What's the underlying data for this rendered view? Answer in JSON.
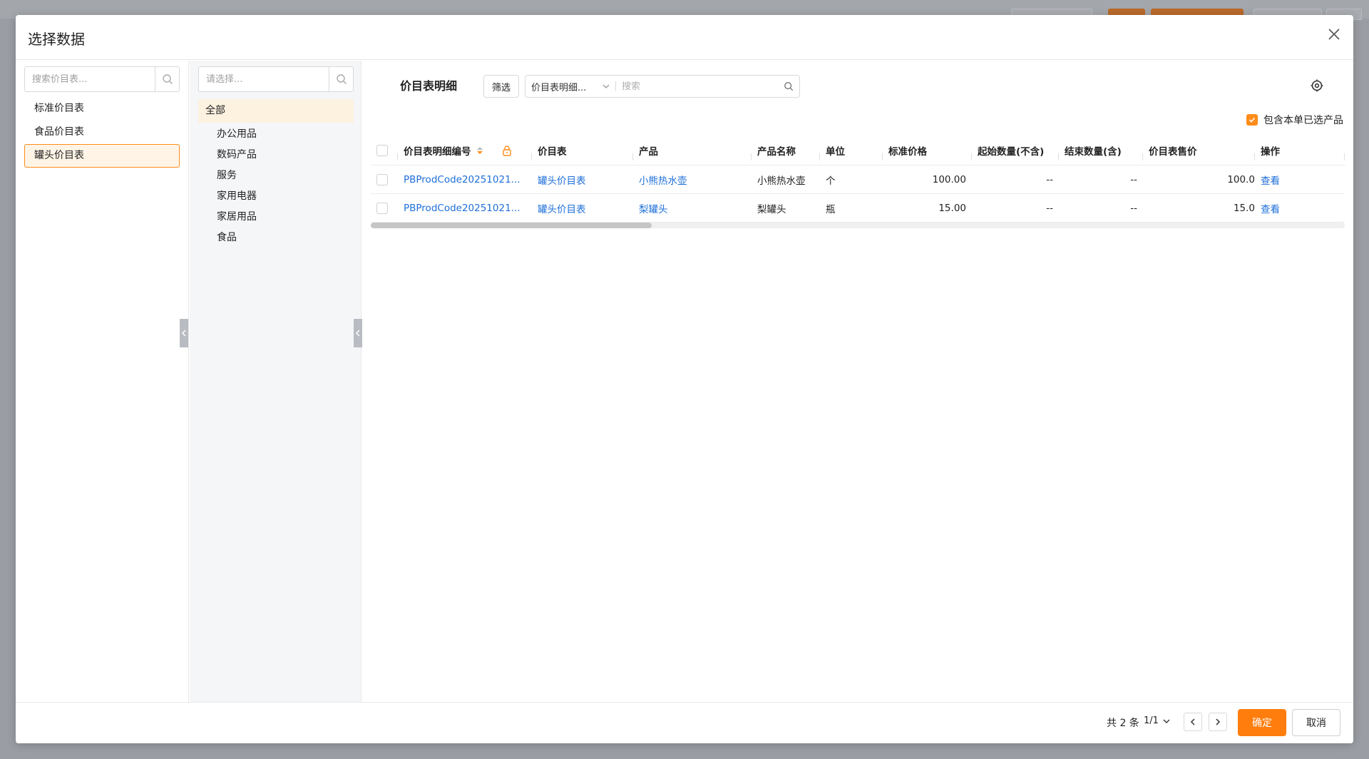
{
  "modal": {
    "title": "选择数据",
    "close_icon": "close-icon"
  },
  "price_list_panel": {
    "search_placeholder": "搜索价目表...",
    "items": [
      {
        "label": "标准价目表",
        "active": false
      },
      {
        "label": "食品价目表",
        "active": false
      },
      {
        "label": "罐头价目表",
        "active": true
      }
    ]
  },
  "category_panel": {
    "search_placeholder": "请选择...",
    "all_label": "全部",
    "items": [
      "办公用品",
      "数码产品",
      "服务",
      "家用电器",
      "家居用品",
      "食品"
    ]
  },
  "detail_panel": {
    "title": "价目表明细",
    "filter_label": "筛选",
    "field_select": "价目表明细...",
    "search_placeholder": "搜索",
    "include_checkbox_label": "包含本单已选产品",
    "include_checked": true
  },
  "table": {
    "columns": [
      "价目表明细编号",
      "价目表",
      "产品",
      "产品名称",
      "单位",
      "标准价格",
      "起始数量(不含)",
      "结束数量(含)",
      "价目表售价",
      "操作"
    ],
    "rows": [
      {
        "code": "PBProdCode20251021...",
        "price_list": "罐头价目表",
        "product": "小熊热水壶",
        "product_name": "小熊热水壶",
        "unit": "个",
        "std_price": "100.00",
        "start_qty": "--",
        "end_qty": "--",
        "sale_price": "100.0",
        "action": "查看"
      },
      {
        "code": "PBProdCode20251021...",
        "price_list": "罐头价目表",
        "product": "梨罐头",
        "product_name": "梨罐头",
        "unit": "瓶",
        "std_price": "15.00",
        "start_qty": "--",
        "end_qty": "--",
        "sale_price": "15.0",
        "action": "查看"
      }
    ]
  },
  "footer": {
    "total": "共 2 条",
    "pages": "1/1",
    "confirm_label": "确定",
    "cancel_label": "取消"
  },
  "colors": {
    "accent": "#ff7d0d",
    "link": "#1e6fd9"
  }
}
